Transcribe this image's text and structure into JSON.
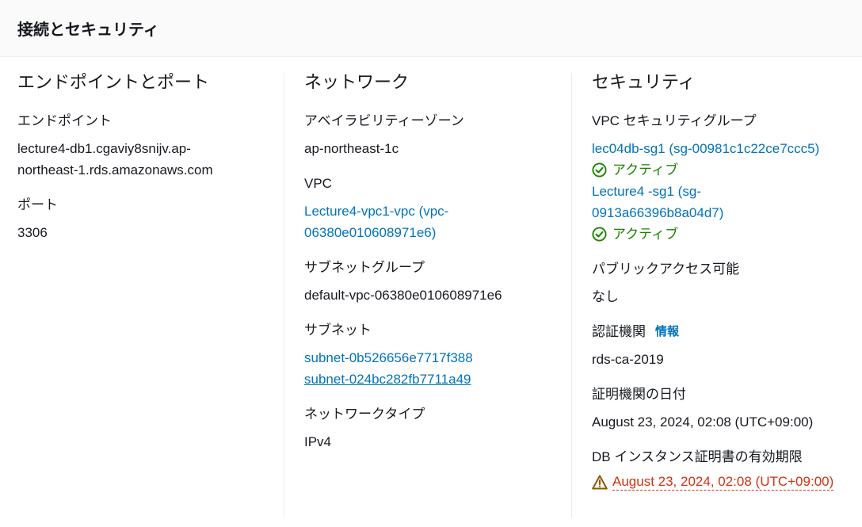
{
  "header": {
    "title": "接続とセキュリティ"
  },
  "endpoint_col": {
    "title": "エンドポイントとポート",
    "endpoint_label": "エンドポイント",
    "endpoint_value": "lecture4-db1.cgaviy8snijv.ap-northeast-1.rds.amazonaws.com",
    "port_label": "ポート",
    "port_value": "3306"
  },
  "network_col": {
    "title": "ネットワーク",
    "az_label": "アベイラビリティーゾーン",
    "az_value": "ap-northeast-1c",
    "vpc_label": "VPC",
    "vpc_value": "Lecture4-vpc1-vpc (vpc-06380e010608971e6)",
    "subnet_group_label": "サブネットグループ",
    "subnet_group_value": "default-vpc-06380e010608971e6",
    "subnet_label": "サブネット",
    "subnets": [
      "subnet-0b526656e7717f388",
      "subnet-024bc282fb7711a49"
    ],
    "network_type_label": "ネットワークタイプ",
    "network_type_value": "IPv4"
  },
  "security_col": {
    "title": "セキュリティ",
    "sg_label": "VPC セキュリティグループ",
    "security_groups": [
      {
        "name": "lec04db-sg1 (sg-00981c1c22ce7ccc5)",
        "status": "アクティブ"
      },
      {
        "name": "Lecture4 -sg1 (sg-0913a66396b8a04d7)",
        "status": "アクティブ"
      }
    ],
    "public_label": "パブリックアクセス可能",
    "public_value": "なし",
    "ca_label": "認証機関",
    "ca_info": "情報",
    "ca_value": "rds-ca-2019",
    "ca_date_label": "証明機関の日付",
    "ca_date_value": "August 23, 2024, 02:08 (UTC+09:00)",
    "cert_expiry_label": "DB インスタンス証明書の有効期限",
    "cert_expiry_value": "August 23, 2024, 02:08 (UTC+09:00)"
  },
  "colors": {
    "link": "#0073bb",
    "success": "#1d8102",
    "warning": "#d13212"
  },
  "icons": {
    "status": "status-check-icon",
    "warning": "warning-triangle-icon"
  }
}
